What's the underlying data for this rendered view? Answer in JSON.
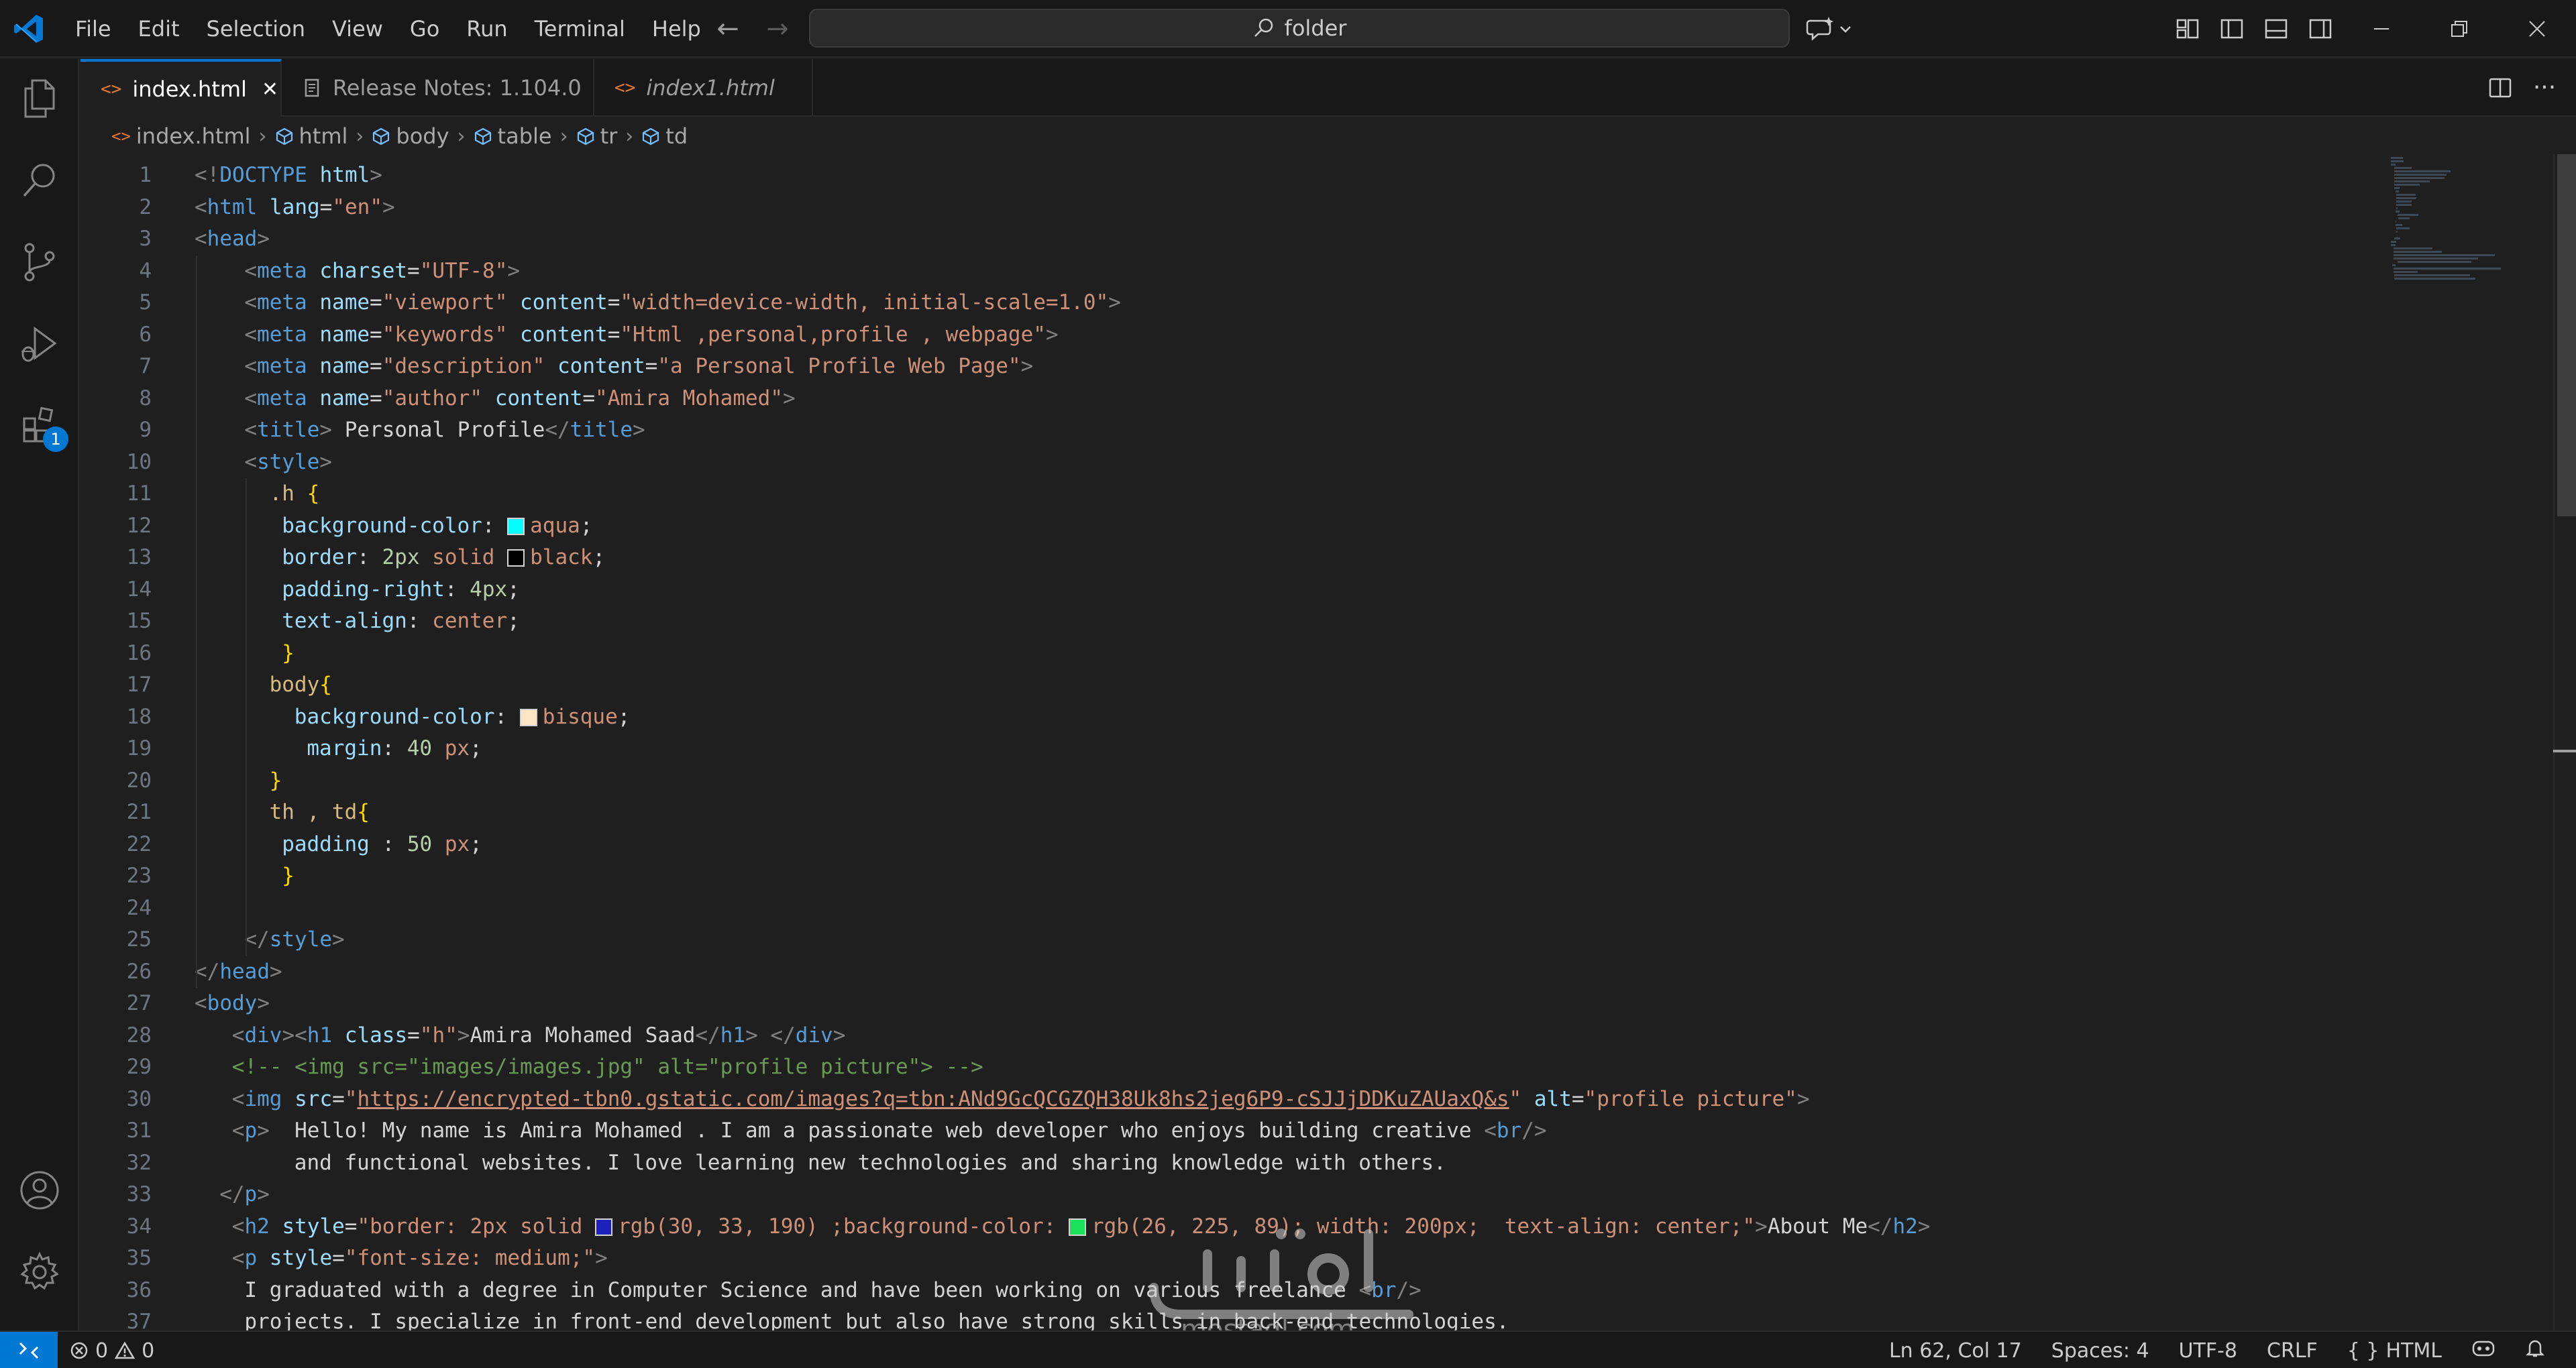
{
  "menu": [
    "File",
    "Edit",
    "Selection",
    "View",
    "Go",
    "Run",
    "Terminal",
    "Help"
  ],
  "search": {
    "text": "folder"
  },
  "tabs": [
    {
      "label": "index.html",
      "active": true,
      "close": "✕"
    },
    {
      "label": "Release Notes: 1.104.0",
      "active": false
    },
    {
      "label": "index1.html",
      "active": false
    }
  ],
  "breadcrumbs": [
    "index.html",
    "html",
    "body",
    "table",
    "tr",
    "td"
  ],
  "activity": {
    "extensions_badge": "1"
  },
  "code_lines": [
    {
      "n": "1",
      "indent": 0,
      "tokens": [
        [
          "br",
          "<!"
        ],
        [
          "tag",
          "DOCTYPE "
        ],
        [
          "attr",
          "html"
        ],
        [
          "br",
          ">"
        ]
      ]
    },
    {
      "n": "2",
      "indent": 0,
      "tokens": [
        [
          "br",
          "<"
        ],
        [
          "tag",
          "html "
        ],
        [
          "attr",
          "lang"
        ],
        [
          "punc",
          "="
        ],
        [
          "str",
          "\"en\""
        ],
        [
          "br",
          ">"
        ]
      ]
    },
    {
      "n": "3",
      "indent": 0,
      "tokens": [
        [
          "br",
          "<"
        ],
        [
          "tag",
          "head"
        ],
        [
          "br",
          ">"
        ]
      ]
    },
    {
      "n": "4",
      "indent": 4,
      "tokens": [
        [
          "br",
          "<"
        ],
        [
          "tag",
          "meta "
        ],
        [
          "attr",
          "charset"
        ],
        [
          "punc",
          "="
        ],
        [
          "str",
          "\"UTF-8\""
        ],
        [
          "br",
          ">"
        ]
      ]
    },
    {
      "n": "5",
      "indent": 4,
      "tokens": [
        [
          "br",
          "<"
        ],
        [
          "tag",
          "meta "
        ],
        [
          "attr",
          "name"
        ],
        [
          "punc",
          "="
        ],
        [
          "str",
          "\"viewport\" "
        ],
        [
          "attr",
          "content"
        ],
        [
          "punc",
          "="
        ],
        [
          "str",
          "\"width=device-width, initial-scale=1.0\""
        ],
        [
          "br",
          ">"
        ]
      ]
    },
    {
      "n": "6",
      "indent": 4,
      "tokens": [
        [
          "br",
          "<"
        ],
        [
          "tag",
          "meta "
        ],
        [
          "attr",
          "name"
        ],
        [
          "punc",
          "="
        ],
        [
          "str",
          "\"keywords\" "
        ],
        [
          "attr",
          "content"
        ],
        [
          "punc",
          "="
        ],
        [
          "str",
          "\"Html ,personal,profile , webpage\""
        ],
        [
          "br",
          ">"
        ]
      ]
    },
    {
      "n": "7",
      "indent": 4,
      "tokens": [
        [
          "br",
          "<"
        ],
        [
          "tag",
          "meta "
        ],
        [
          "attr",
          "name"
        ],
        [
          "punc",
          "="
        ],
        [
          "str",
          "\"description\" "
        ],
        [
          "attr",
          "content"
        ],
        [
          "punc",
          "="
        ],
        [
          "str",
          "\"a Personal Profile Web Page\""
        ],
        [
          "br",
          ">"
        ]
      ]
    },
    {
      "n": "8",
      "indent": 4,
      "tokens": [
        [
          "br",
          "<"
        ],
        [
          "tag",
          "meta "
        ],
        [
          "attr",
          "name"
        ],
        [
          "punc",
          "="
        ],
        [
          "str",
          "\"author\" "
        ],
        [
          "attr",
          "content"
        ],
        [
          "punc",
          "="
        ],
        [
          "str",
          "\"Amira Mohamed\""
        ],
        [
          "br",
          ">"
        ]
      ]
    },
    {
      "n": "9",
      "indent": 4,
      "tokens": [
        [
          "br",
          "<"
        ],
        [
          "tag",
          "title"
        ],
        [
          "br",
          "> "
        ],
        [
          "txt",
          "Personal Profile"
        ],
        [
          "br",
          "</"
        ],
        [
          "tag",
          "title"
        ],
        [
          "br",
          ">"
        ]
      ]
    },
    {
      "n": "10",
      "indent": 4,
      "tokens": [
        [
          "br",
          "<"
        ],
        [
          "tag",
          "style"
        ],
        [
          "br",
          ">"
        ]
      ]
    },
    {
      "n": "11",
      "indent": 6,
      "tokens": [
        [
          "sel",
          ".h "
        ],
        [
          "brace",
          "{"
        ]
      ]
    },
    {
      "n": "12",
      "indent": 7,
      "tokens": [
        [
          "prop",
          "background-color"
        ],
        [
          "punc",
          ": "
        ],
        [
          "swatch",
          "#00ffff"
        ],
        [
          "val",
          "aqua"
        ],
        [
          "punc",
          ";"
        ]
      ]
    },
    {
      "n": "13",
      "indent": 7,
      "tokens": [
        [
          "prop",
          "border"
        ],
        [
          "punc",
          ": "
        ],
        [
          "num",
          "2px "
        ],
        [
          "val",
          "solid "
        ],
        [
          "swatch",
          "#000000"
        ],
        [
          "val",
          "black"
        ],
        [
          "punc",
          ";"
        ]
      ]
    },
    {
      "n": "14",
      "indent": 7,
      "tokens": [
        [
          "prop",
          "padding-right"
        ],
        [
          "punc",
          ": "
        ],
        [
          "num",
          "4px"
        ],
        [
          "punc",
          ";"
        ]
      ]
    },
    {
      "n": "15",
      "indent": 7,
      "tokens": [
        [
          "prop",
          "text-align"
        ],
        [
          "punc",
          ": "
        ],
        [
          "val",
          "center"
        ],
        [
          "punc",
          ";"
        ]
      ]
    },
    {
      "n": "16",
      "indent": 7,
      "tokens": [
        [
          "brace",
          "}"
        ]
      ]
    },
    {
      "n": "17",
      "indent": 6,
      "tokens": [
        [
          "sel",
          "body"
        ],
        [
          "brace",
          "{"
        ]
      ]
    },
    {
      "n": "18",
      "indent": 8,
      "tokens": [
        [
          "prop",
          "background-color"
        ],
        [
          "punc",
          ": "
        ],
        [
          "swatch",
          "#ffe4c4"
        ],
        [
          "val",
          "bisque"
        ],
        [
          "punc",
          ";"
        ]
      ]
    },
    {
      "n": "19",
      "indent": 9,
      "tokens": [
        [
          "prop",
          "margin"
        ],
        [
          "punc",
          ": "
        ],
        [
          "num",
          "40 "
        ],
        [
          "val",
          "px"
        ],
        [
          "punc",
          ";"
        ]
      ]
    },
    {
      "n": "20",
      "indent": 6,
      "tokens": [
        [
          "brace",
          "}"
        ]
      ]
    },
    {
      "n": "21",
      "indent": 6,
      "tokens": [
        [
          "sel",
          "th , td"
        ],
        [
          "brace",
          "{"
        ]
      ]
    },
    {
      "n": "22",
      "indent": 7,
      "tokens": [
        [
          "prop",
          "padding "
        ],
        [
          "punc",
          ": "
        ],
        [
          "num",
          "50 "
        ],
        [
          "val",
          "px"
        ],
        [
          "punc",
          ";"
        ]
      ]
    },
    {
      "n": "23",
      "indent": 7,
      "tokens": [
        [
          "brace",
          "}"
        ]
      ]
    },
    {
      "n": "24",
      "indent": 0,
      "tokens": []
    },
    {
      "n": "25",
      "indent": 4,
      "tokens": [
        [
          "br",
          "</"
        ],
        [
          "tag",
          "style"
        ],
        [
          "br",
          ">"
        ]
      ]
    },
    {
      "n": "26",
      "indent": 0,
      "tokens": [
        [
          "br",
          "</"
        ],
        [
          "tag",
          "head"
        ],
        [
          "br",
          ">"
        ]
      ]
    },
    {
      "n": "27",
      "indent": 0,
      "tokens": [
        [
          "br",
          "<"
        ],
        [
          "tag",
          "body"
        ],
        [
          "br",
          ">"
        ]
      ]
    },
    {
      "n": "28",
      "indent": 3,
      "tokens": [
        [
          "br",
          "<"
        ],
        [
          "tag",
          "div"
        ],
        [
          "br",
          "><"
        ],
        [
          "tag",
          "h1 "
        ],
        [
          "attr",
          "class"
        ],
        [
          "punc",
          "="
        ],
        [
          "str",
          "\"h\""
        ],
        [
          "br",
          ">"
        ],
        [
          "txt",
          "Amira Mohamed Saad"
        ],
        [
          "br",
          "</"
        ],
        [
          "tag",
          "h1"
        ],
        [
          "br",
          "> </"
        ],
        [
          "tag",
          "div"
        ],
        [
          "br",
          ">"
        ]
      ]
    },
    {
      "n": "29",
      "indent": 3,
      "tokens": [
        [
          "com",
          "<!-- <img src=\"images/images.jpg\" alt=\"profile picture\"> -->"
        ]
      ]
    },
    {
      "n": "30",
      "indent": 3,
      "tokens": [
        [
          "br",
          "<"
        ],
        [
          "tag",
          "img "
        ],
        [
          "attr",
          "src"
        ],
        [
          "punc",
          "="
        ],
        [
          "str",
          "\""
        ],
        [
          "link",
          "https://encrypted-tbn0.gstatic.com/images?q=tbn:ANd9GcQCGZQH38Uk8hs2jeg6P9-cSJJjDDKuZAUaxQ&s"
        ],
        [
          "str",
          "\" "
        ],
        [
          "attr",
          "alt"
        ],
        [
          "punc",
          "="
        ],
        [
          "str",
          "\"profile picture\""
        ],
        [
          "br",
          ">"
        ]
      ]
    },
    {
      "n": "31",
      "indent": 3,
      "tokens": [
        [
          "br",
          "<"
        ],
        [
          "tag",
          "p"
        ],
        [
          "br",
          ">  "
        ],
        [
          "txt",
          "Hello! My name is Amira Mohamed . I am a passionate web developer who enjoys building creative "
        ],
        [
          "br",
          "<"
        ],
        [
          "tag",
          "br"
        ],
        [
          "br",
          "/>"
        ]
      ]
    },
    {
      "n": "32",
      "indent": 8,
      "tokens": [
        [
          "txt",
          "and functional websites. I love learning new technologies and sharing knowledge with others."
        ]
      ]
    },
    {
      "n": "33",
      "indent": 2,
      "tokens": [
        [
          "br",
          "</"
        ],
        [
          "tag",
          "p"
        ],
        [
          "br",
          ">"
        ]
      ]
    },
    {
      "n": "34",
      "indent": 3,
      "tokens": [
        [
          "br",
          "<"
        ],
        [
          "tag",
          "h2 "
        ],
        [
          "attr",
          "style"
        ],
        [
          "punc",
          "="
        ],
        [
          "str",
          "\"border: 2px solid "
        ],
        [
          "swatch",
          "#1e21be"
        ],
        [
          "str",
          "rgb(30, 33, 190) ;background-color: "
        ],
        [
          "swatch",
          "#1ae159"
        ],
        [
          "str",
          "rgb(26, 225, 89); width: 200px;  text-align: center;\""
        ],
        [
          "br",
          ">"
        ],
        [
          "txt",
          "About Me"
        ],
        [
          "br",
          "</"
        ],
        [
          "tag",
          "h2"
        ],
        [
          "br",
          ">"
        ]
      ]
    },
    {
      "n": "35",
      "indent": 3,
      "tokens": [
        [
          "br",
          "<"
        ],
        [
          "tag",
          "p "
        ],
        [
          "attr",
          "style"
        ],
        [
          "punc",
          "="
        ],
        [
          "str",
          "\"font-size: medium;\""
        ],
        [
          "br",
          ">"
        ]
      ]
    },
    {
      "n": "36",
      "indent": 4,
      "tokens": [
        [
          "txt",
          "I graduated with a degree in Computer Science and have been working on various freelance "
        ],
        [
          "br",
          "<"
        ],
        [
          "tag",
          "br"
        ],
        [
          "br",
          "/>"
        ]
      ]
    },
    {
      "n": "37",
      "indent": 4,
      "tokens": [
        [
          "txt",
          "projects. I specialize in front-end development but also have strong skills in back-end technologies."
        ]
      ]
    }
  ],
  "status": {
    "errors": "0",
    "warnings": "0",
    "position": "Ln 62, Col 17",
    "spaces": "Spaces: 4",
    "encoding": "UTF-8",
    "eol": "CRLF",
    "language": "HTML"
  },
  "colors": {
    "accent": "#0078d4",
    "editor_bg": "#1f1f1f",
    "chrome_bg": "#181818"
  }
}
